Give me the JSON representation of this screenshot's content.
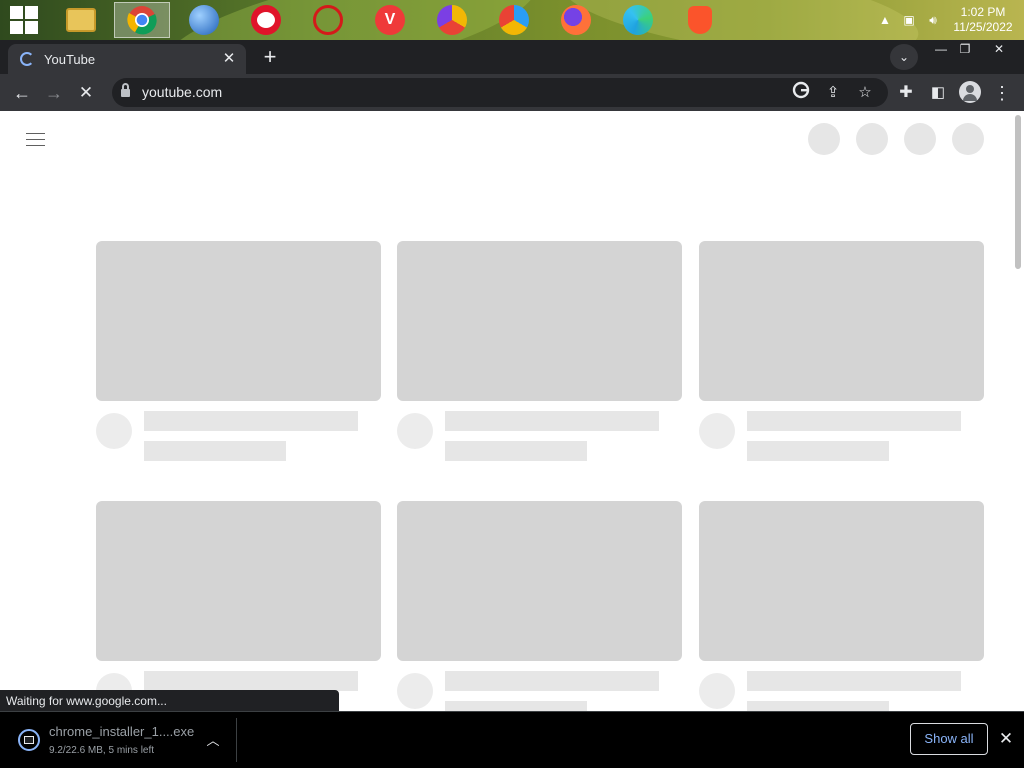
{
  "taskbar": {
    "start_icon": "windows-logo-icon",
    "apps": [
      {
        "name": "file-explorer-icon",
        "color": "#e8c55a",
        "active": false
      },
      {
        "name": "chrome-icon",
        "color": "#4285f4",
        "active": true
      },
      {
        "name": "globe-browser-icon",
        "color": "#3a7bd5",
        "active": false
      },
      {
        "name": "opera-icon",
        "color": "#e0142a",
        "active": false
      },
      {
        "name": "opera-gx-icon",
        "color": "#d41a1a",
        "active": false
      },
      {
        "name": "vivaldi-icon",
        "color": "#ef3939",
        "active": false
      },
      {
        "name": "browser-yellow-icon",
        "color": "#f2b705",
        "active": false
      },
      {
        "name": "browser-blue-icon",
        "color": "#2a9df4",
        "active": false
      },
      {
        "name": "firefox-icon",
        "color": "#ff7139",
        "active": false
      },
      {
        "name": "edge-icon",
        "color": "#1fa2e0",
        "active": false
      },
      {
        "name": "brave-icon",
        "color": "#fb542b",
        "active": false
      }
    ],
    "tray": {
      "time": "1:02 PM",
      "date": "11/25/2022"
    }
  },
  "tabs": [
    {
      "title": "YouTube",
      "close": "✕"
    }
  ],
  "new_tab": "+",
  "window_controls": {
    "minimize": "—",
    "maximize": "❐",
    "close": "✕"
  },
  "toolbar": {
    "url": "youtube.com"
  },
  "page": {
    "skeleton_rows": 2,
    "skeleton_cols": 3
  },
  "status_bubble": "Waiting for www.google.com...",
  "download": {
    "filename": "chrome_installer_1....exe",
    "status": "9.2/22.6 MB, 5 mins left",
    "show_all": "Show all"
  },
  "colors": {
    "chrome_dark": "#202124",
    "chrome_toolbar": "#35363a",
    "skeleton_thumb": "#d4d4d4",
    "skeleton_line": "#e6e6e6",
    "link_blue": "#8ab4f8"
  }
}
